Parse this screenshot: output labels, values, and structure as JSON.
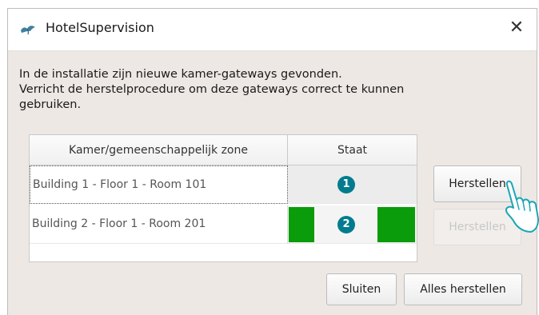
{
  "window": {
    "title": "HotelSupervision",
    "close_glyph": "✕"
  },
  "message": {
    "lines": [
      "In de installatie zijn nieuwe kamer-gateways gevonden.",
      "Verricht de herstelprocedure om deze gateways correct te kunnen",
      "gebruiken."
    ]
  },
  "table": {
    "headers": [
      "Kamer/gemeenschappelijk zone",
      "Staat"
    ],
    "rows": [
      {
        "room": "Building 1 - Floor 1 - Room 101",
        "badge": "1",
        "status": "pending"
      },
      {
        "room": "Building 2 - Floor 1 - Room 201",
        "badge": "2",
        "status": "in-progress"
      }
    ]
  },
  "buttons": {
    "restore_row1": "Herstellen",
    "restore_row2": "Herstellen",
    "restore_row2_state": "disabled",
    "close": "Sluiten",
    "restore_all": "Alles herstellen"
  },
  "icons": {
    "app": "app-logo-icon",
    "pointer": "hand-pointer-icon"
  },
  "colors": {
    "progress_green": "#0a9c0a",
    "badge_teal": "#007c8e",
    "dialog_background": "#ede8e4"
  }
}
